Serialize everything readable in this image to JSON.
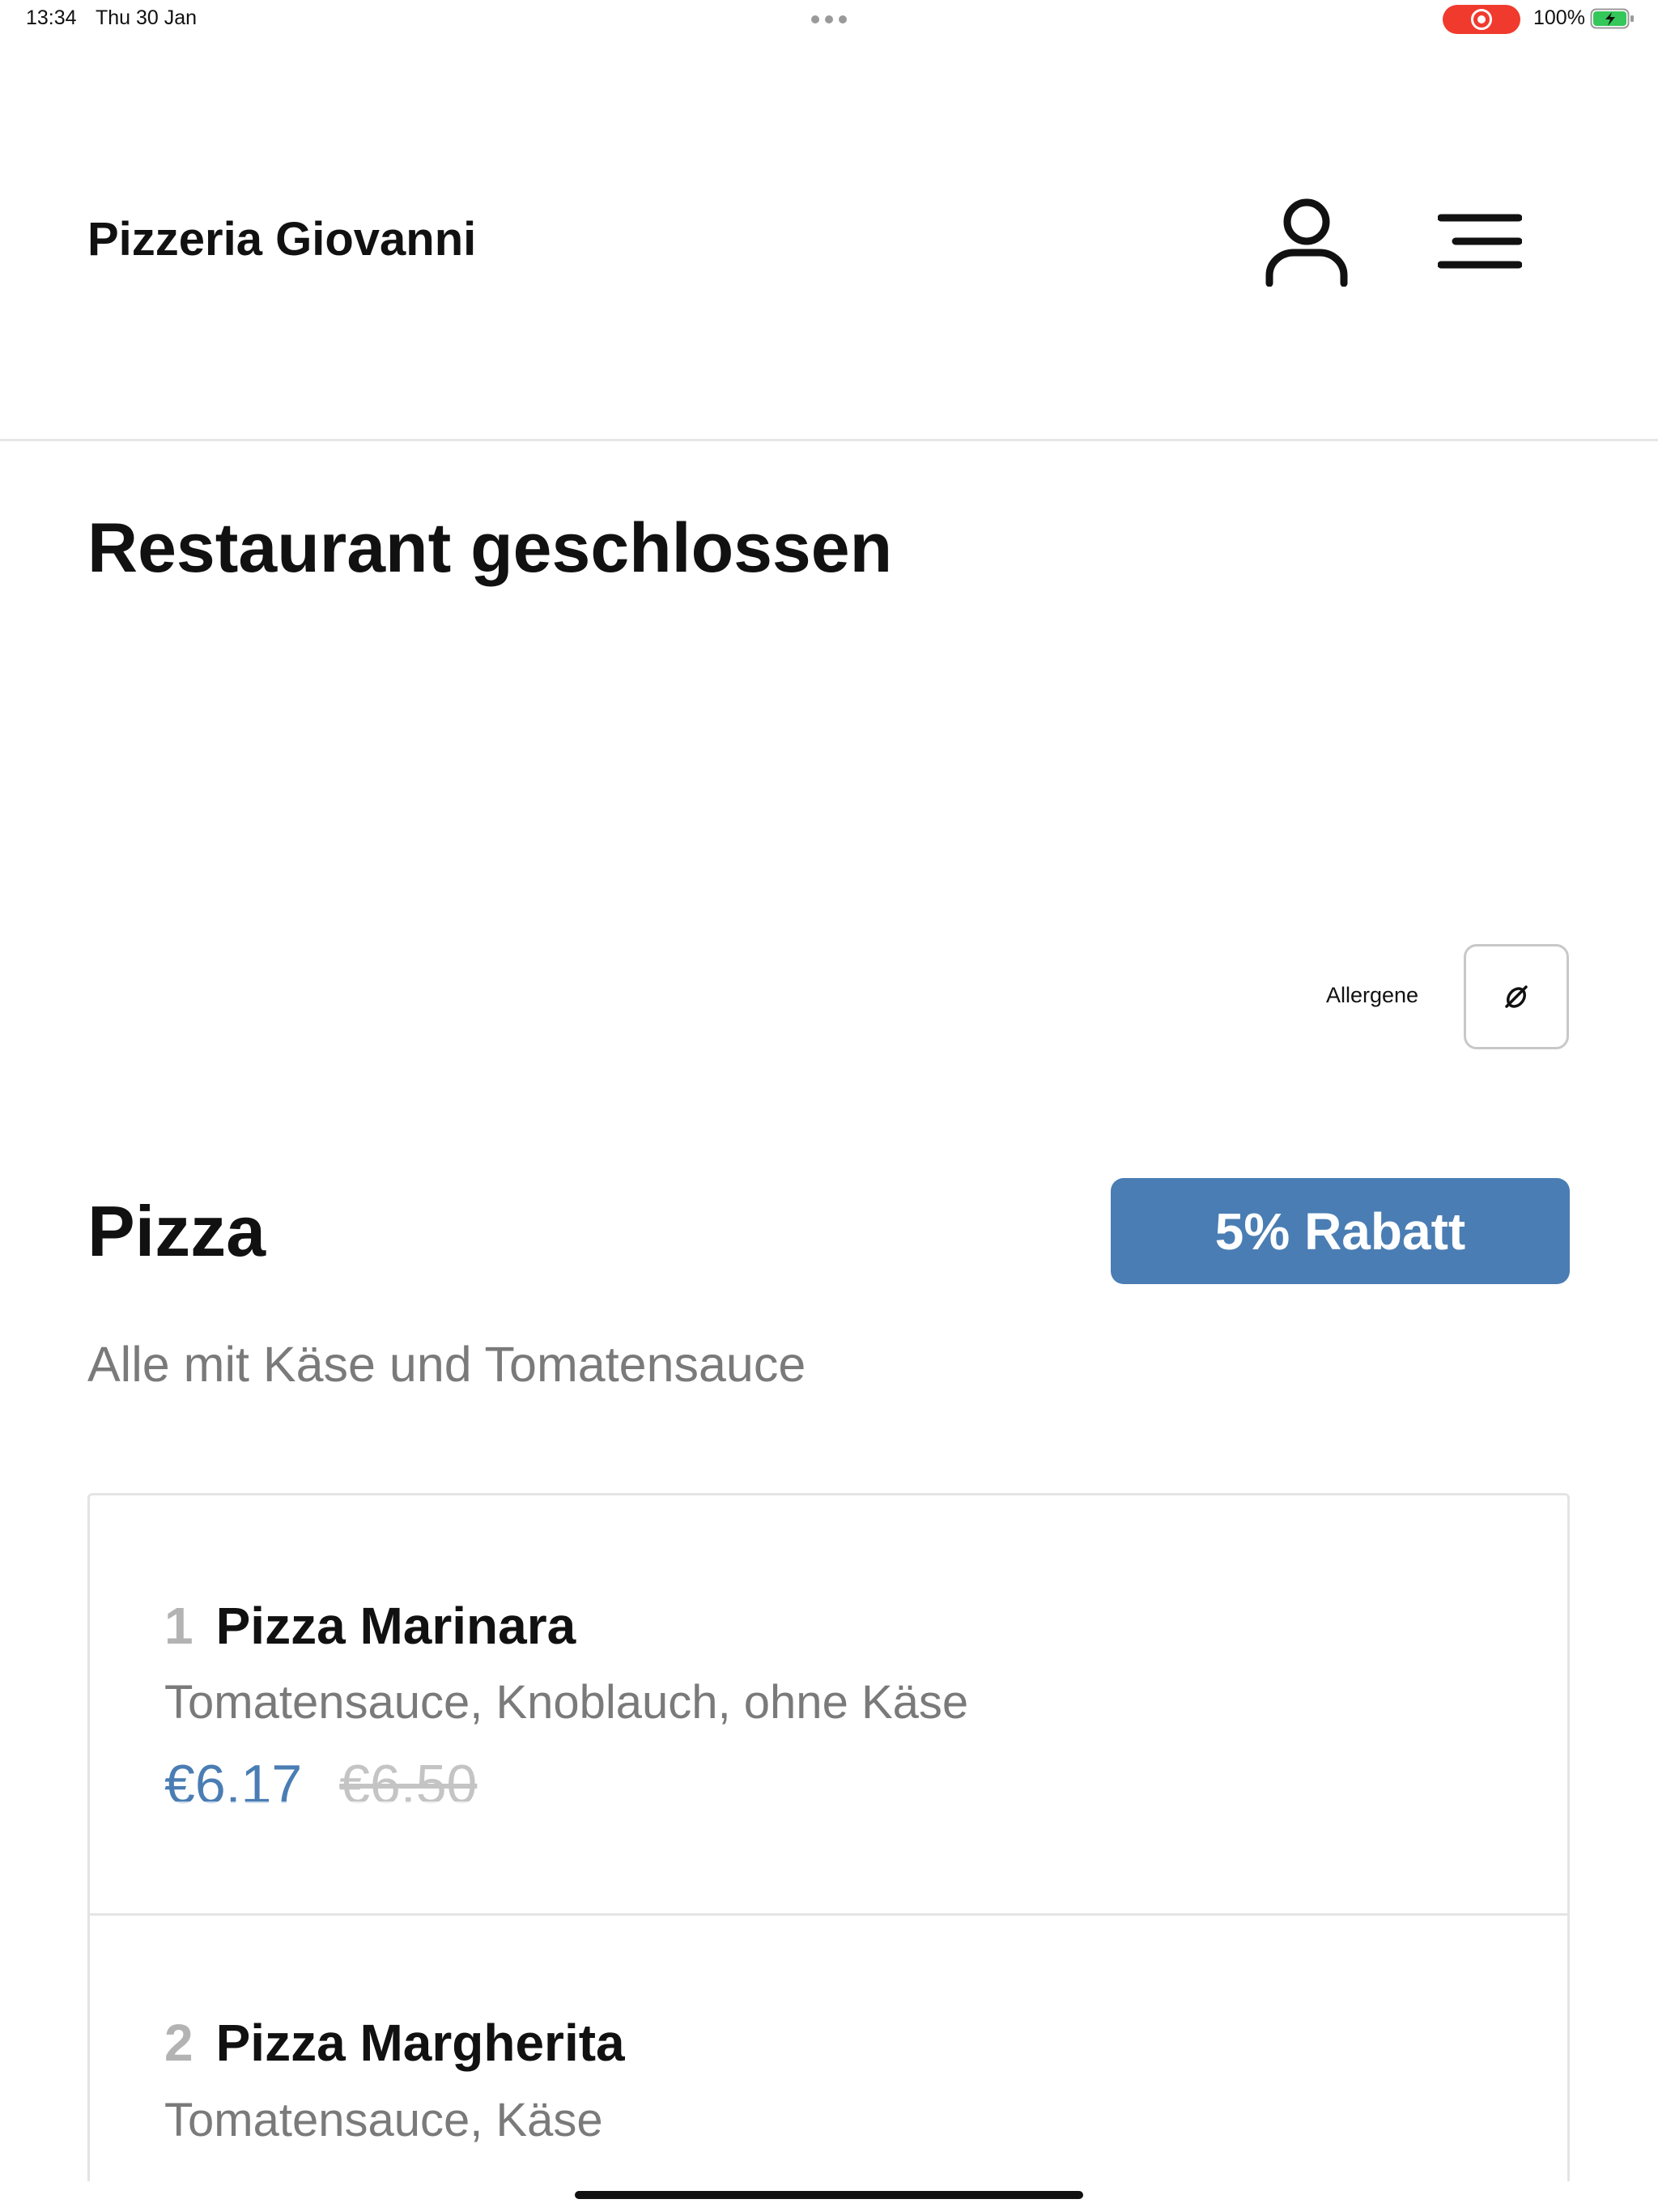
{
  "status_bar": {
    "time": "13:34",
    "date": "Thu 30 Jan",
    "battery": "100%"
  },
  "header": {
    "brand": "Pizzeria Giovanni"
  },
  "main": {
    "closed_title": "Restaurant geschlossen",
    "allergens_label": "Allergene"
  },
  "section": {
    "title": "Pizza",
    "discount": "5% Rabatt",
    "description": "Alle mit Käse und Tomatensauce",
    "items": [
      {
        "number": "1",
        "name": "Pizza Marinara",
        "description": "Tomatensauce, Knoblauch, ohne Käse",
        "price": "€6.17",
        "old_price": "€6.50"
      },
      {
        "number": "2",
        "name": "Pizza Margherita",
        "description": "Tomatensauce, Käse"
      }
    ]
  },
  "colors": {
    "accent": "#4a7db3",
    "record": "#f03a2e",
    "muted_text": "#7a7a7a",
    "battery_green": "#34c759"
  },
  "icons": {
    "account": "user-icon",
    "menu": "hamburger-menu-icon",
    "allergens": "allergen-filter-icon"
  }
}
